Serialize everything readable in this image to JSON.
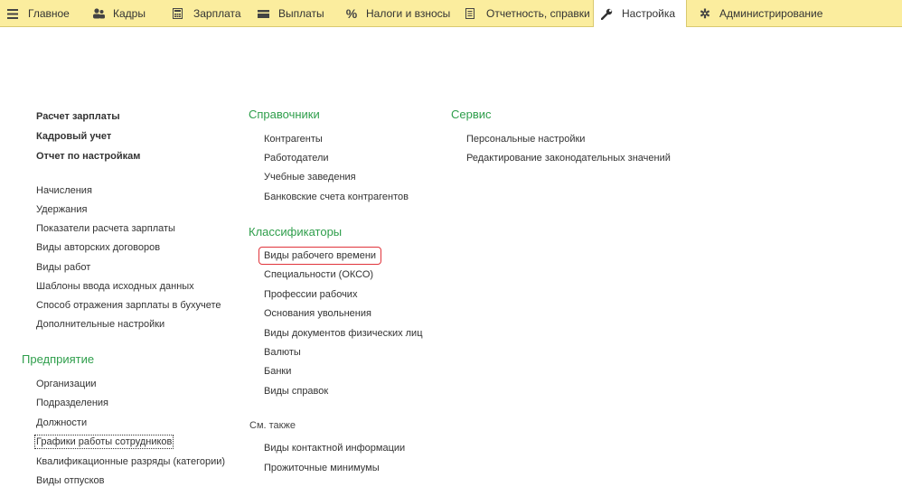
{
  "menu": {
    "tabs": [
      {
        "label": "Главное",
        "icon": "hamburger-icon"
      },
      {
        "label": "Кадры",
        "icon": "users-icon"
      },
      {
        "label": "Зарплата",
        "icon": "calculator-icon"
      },
      {
        "label": "Выплаты",
        "icon": "wallet-icon"
      },
      {
        "label": "Налоги и взносы",
        "icon": "percent-icon"
      },
      {
        "label": "Отчетность, справки",
        "icon": "report-icon"
      },
      {
        "label": "Настройка",
        "icon": "wrench-icon"
      },
      {
        "label": "Администрирование",
        "icon": "gear-icon"
      }
    ],
    "active_tab": "Настройка"
  },
  "left_column": {
    "main_items": [
      "Расчет зарплаты",
      "Кадровый учет",
      "Отчет по настройкам"
    ],
    "items": [
      "Начисления",
      "Удержания",
      "Показатели расчета зарплаты",
      "Виды авторских договоров",
      "Виды работ",
      "Шаблоны ввода исходных данных",
      "Способ отражения зарплаты в бухучете",
      "Дополнительные настройки"
    ],
    "enterprise_title": "Предприятие",
    "enterprise_items": [
      "Организации",
      "Подразделения",
      "Должности",
      "Графики работы сотрудников",
      "Квалификационные разряды (категории)",
      "Виды отпусков"
    ]
  },
  "middle_column": {
    "directories_title": "Справочники",
    "directories_items": [
      "Контрагенты",
      "Работодатели",
      "Учебные заведения",
      "Банковские счета контрагентов"
    ],
    "classifiers_title": "Классификаторы",
    "classifiers_items": [
      "Виды рабочего времени",
      "Специальности (ОКСО)",
      "Профессии рабочих",
      "Основания увольнения",
      "Виды документов физических лиц",
      "Валюты",
      "Банки",
      "Виды справок"
    ],
    "see_also_title": "См. также",
    "see_also_items": [
      "Виды контактной информации",
      "Прожиточные минимумы"
    ]
  },
  "right_column": {
    "service_title": "Сервис",
    "service_items": [
      "Персональные настройки",
      "Редактирование законодательных значений"
    ]
  },
  "colors": {
    "menu_bg": "#fbed9e",
    "section_title": "#2e9e4b",
    "highlight_border": "#e0343b"
  }
}
